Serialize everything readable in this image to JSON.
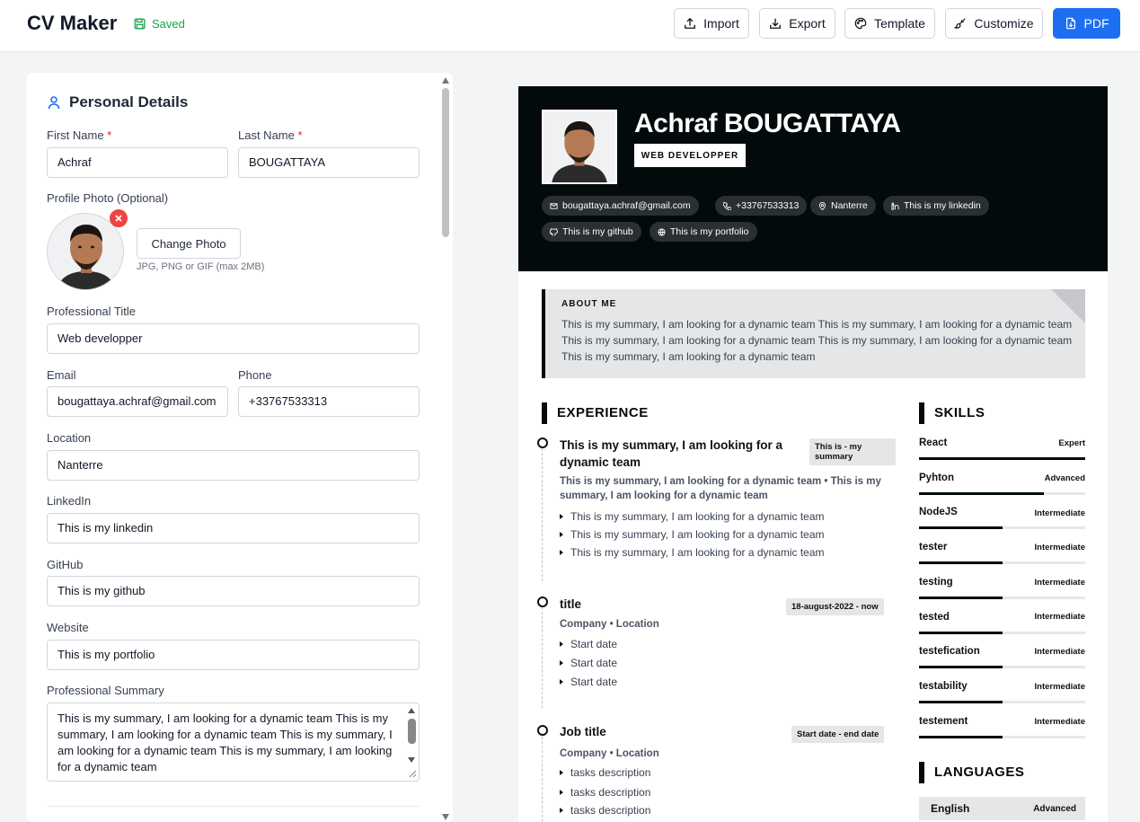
{
  "header": {
    "app_title": "CV Maker",
    "saved_label": "Saved",
    "buttons": {
      "import": "Import",
      "export": "Export",
      "template": "Template",
      "customize": "Customize",
      "pdf": "PDF"
    }
  },
  "form": {
    "section_title": "Personal Details",
    "first_name": {
      "label": "First Name",
      "required_mark": "*",
      "value": "Achraf"
    },
    "last_name": {
      "label": "Last Name",
      "required_mark": "*",
      "value": "BOUGATTAYA"
    },
    "photo": {
      "label": "Profile Photo (Optional)",
      "change_button": "Change Photo",
      "hint": "JPG, PNG or GIF (max 2MB)"
    },
    "professional_title": {
      "label": "Professional Title",
      "value": "Web developper"
    },
    "email": {
      "label": "Email",
      "value": "bougattaya.achraf@gmail.com"
    },
    "phone": {
      "label": "Phone",
      "value": "+33767533313"
    },
    "location": {
      "label": "Location",
      "value": "Nanterre"
    },
    "linkedin": {
      "label": "LinkedIn",
      "value": "This is my linkedin"
    },
    "github": {
      "label": "GitHub",
      "value": "This is my github"
    },
    "website": {
      "label": "Website",
      "value": "This is my portfolio"
    },
    "summary": {
      "label": "Professional Summary",
      "value": "This is my summary, I am looking for a dynamic team This is my summary, I am looking for a dynamic team This is my summary, I am looking for a dynamic team This is my summary, I am looking for a dynamic team"
    }
  },
  "cv": {
    "name": "Achraf BOUGATTAYA",
    "title": "WEB DEVELOPPER",
    "contacts": {
      "email": "bougattaya.achraf@gmail.com",
      "phone": "+33767533313",
      "location": "Nanterre",
      "linkedin": "This is my linkedin",
      "github": "This is my github",
      "portfolio": "This is my portfolio"
    },
    "about": {
      "heading": "ABOUT ME",
      "text": "This is my summary, I am looking for a dynamic team This is my summary, I am looking for a dynamic team This is my summary, I am looking for a dynamic team This is my summary, I am looking for a dynamic team This is my summary, I am looking for a dynamic team"
    },
    "experience_heading": "EXPERIENCE",
    "experience": [
      {
        "title": "This is my summary, I am looking for a dynamic team",
        "date": "This is - my summary",
        "subtitle": "This is my summary, I am looking for a dynamic team • This is my summary, I am looking for a dynamic team",
        "bullets": [
          "This is my summary, I am looking for a dynamic team",
          "This is my summary, I am looking for a dynamic team",
          "This is my summary, I am looking for a dynamic team"
        ]
      },
      {
        "title": "title",
        "date": "18-august-2022 - now",
        "subtitle": "Company • Location",
        "bullets": [
          "Start date",
          "Start date",
          "Start date"
        ]
      },
      {
        "title": "Job title",
        "date": "Start date - end date",
        "subtitle": "Company • Location",
        "bullets": [
          "tasks description",
          "tasks description",
          "tasks description"
        ]
      }
    ],
    "skills_heading": "SKILLS",
    "skills": [
      {
        "name": "React",
        "level": "Expert",
        "fill": 1.0
      },
      {
        "name": "Pyhton",
        "level": "Advanced",
        "fill": 0.75
      },
      {
        "name": "NodeJS",
        "level": "Intermediate",
        "fill": 0.5
      },
      {
        "name": "tester",
        "level": "Intermediate",
        "fill": 0.5
      },
      {
        "name": "testing",
        "level": "Intermediate",
        "fill": 0.5
      },
      {
        "name": "tested",
        "level": "Intermediate",
        "fill": 0.5
      },
      {
        "name": "testefication",
        "level": "Intermediate",
        "fill": 0.5
      },
      {
        "name": "testability",
        "level": "Intermediate",
        "fill": 0.5
      },
      {
        "name": "testement",
        "level": "Intermediate",
        "fill": 0.5
      }
    ],
    "languages_heading": "LANGUAGES",
    "languages": [
      {
        "name": "English",
        "level": "Advanced"
      }
    ]
  },
  "colors": {
    "accent": "#1d6ff2",
    "saved_green": "#16a34a",
    "cv_dark": "#030a0b",
    "required_red": "#dc2626"
  },
  "icons": {
    "saved": "floppy-disk-icon",
    "import": "upload-icon",
    "export": "download-icon",
    "template": "palette-icon",
    "customize": "brush-icon",
    "pdf": "file-icon",
    "section": "user-icon"
  }
}
